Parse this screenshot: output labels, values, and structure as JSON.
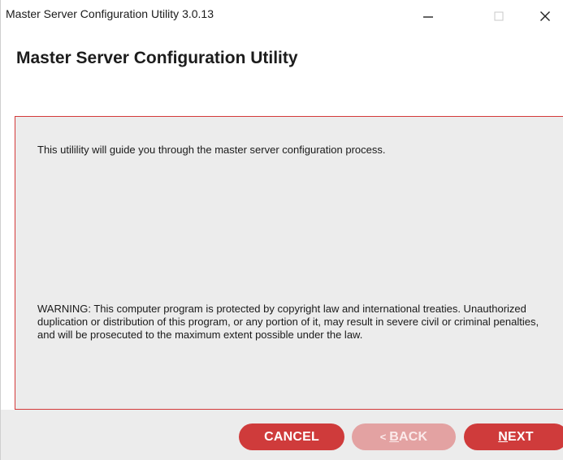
{
  "window": {
    "title": "Master Server Configuration Utility 3.0.13",
    "controls": {
      "minimize_glyph": "—",
      "maximize_glyph": "□",
      "close_glyph": "✕"
    }
  },
  "header": {
    "title": "Master Server Configuration Utility"
  },
  "content": {
    "intro": "This utilility will guide you through the master server configuration process.",
    "warning": "WARNING: This computer program is protected by copyright law and international treaties. Unauthorized duplication or distribution of this program, or any portion of it, may result in severe civil or criminal penalties, and will be prosecuted to the maximum extent possible under the law."
  },
  "footer": {
    "buttons": {
      "cancel_label": "CANCEL",
      "back_arrow": "<",
      "back_label": "BACK",
      "next_label": "NEXT"
    }
  },
  "colors": {
    "accent": "#cf3b3b",
    "accent_disabled": "#e3a2a2",
    "panel_border": "#d33a3a",
    "panel_background": "#ececec"
  }
}
